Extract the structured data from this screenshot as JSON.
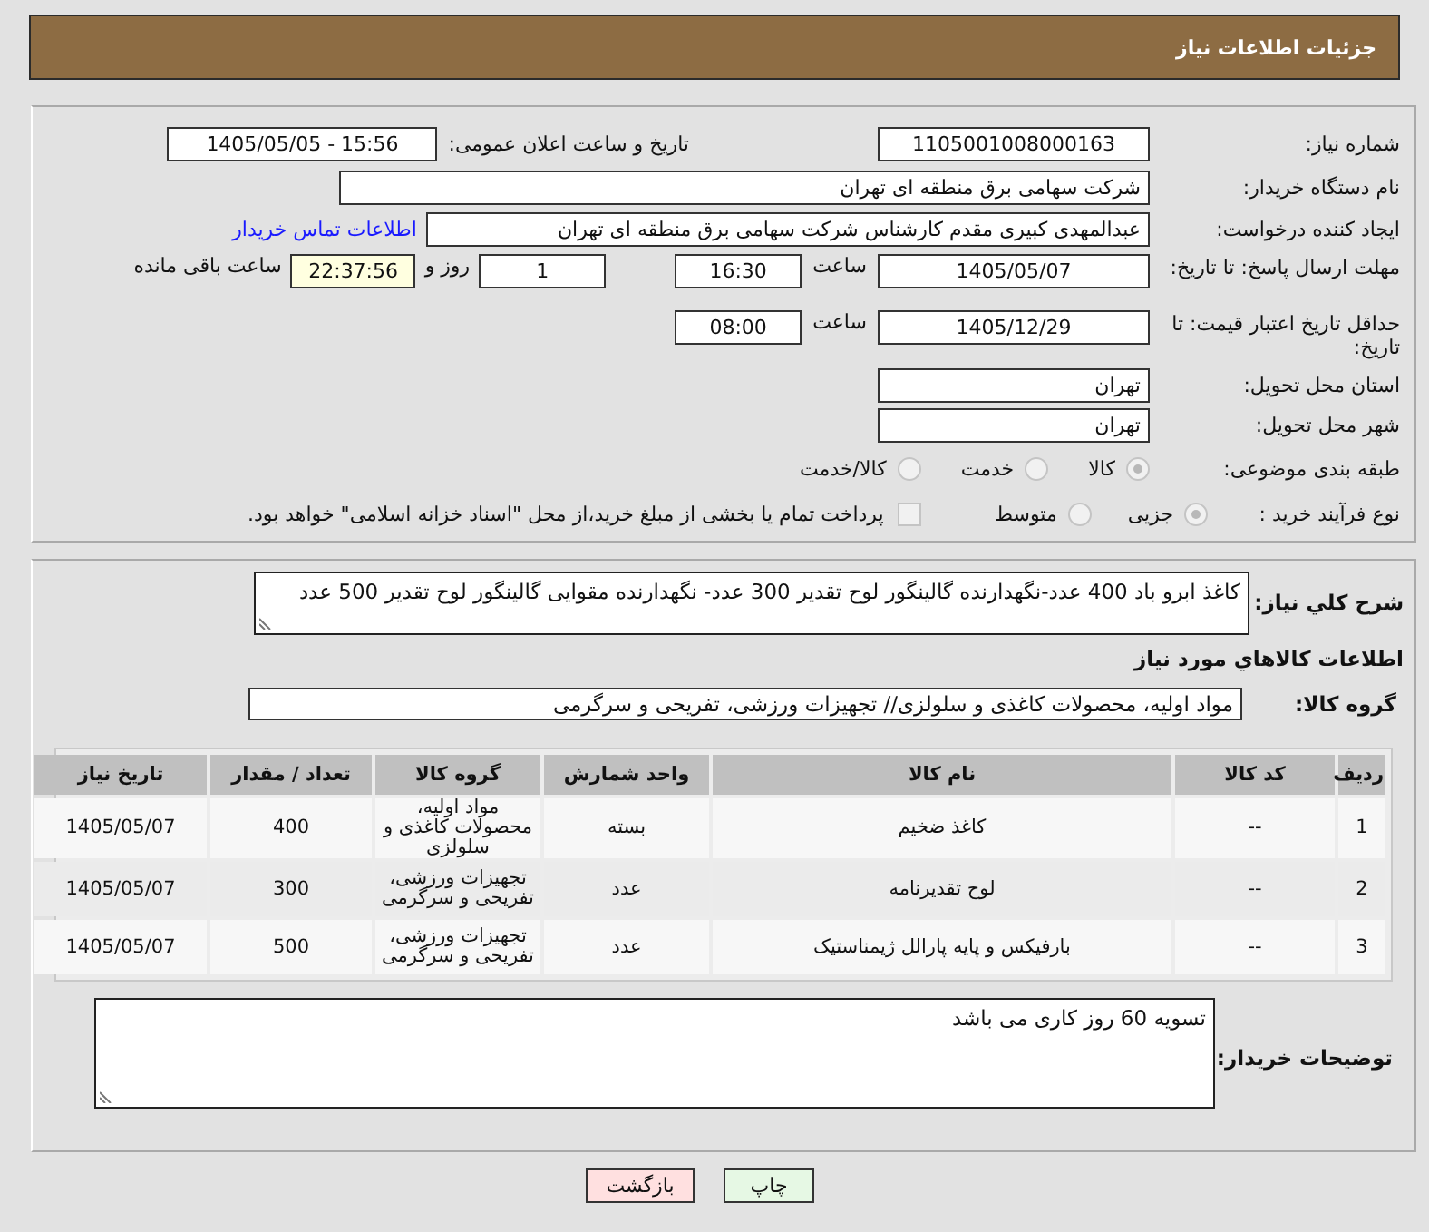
{
  "header": {
    "title": "جزئیات اطلاعات نیاز"
  },
  "info": {
    "need_number": {
      "label": "شماره نیاز:",
      "value": "1105001008000163"
    },
    "announce": {
      "label": "تاریخ و ساعت اعلان عمومی:",
      "value": "1405/05/05 - 15:56"
    },
    "buyer_org": {
      "label": "نام دستگاه خریدار:",
      "value": "شرکت سهامی برق منطقه ای تهران"
    },
    "requester": {
      "label": "ایجاد کننده درخواست:",
      "value": "عبدالمهدی کبیری مقدم کارشناس شرکت سهامی برق منطقه ای تهران",
      "link": "اطلاعات تماس خریدار"
    },
    "reply_deadline": {
      "label": "مهلت ارسال پاسخ: تا تاریخ:",
      "date": "1405/05/07",
      "time_label": "ساعت",
      "time": "16:30",
      "days": "1",
      "days_label": "روز و",
      "remaining": "22:37:56",
      "remaining_label": "ساعت باقی مانده"
    },
    "price_validity": {
      "label": "حداقل تاریخ اعتبار قیمت: تا تاریخ:",
      "date": "1405/12/29",
      "time_label": "ساعت",
      "time": "08:00"
    },
    "province": {
      "label": "استان محل تحویل:",
      "value": "تهران"
    },
    "city": {
      "label": "شهر محل تحویل:",
      "value": "تهران"
    },
    "category": {
      "label": "طبقه بندی موضوعی:",
      "options": [
        {
          "label": "کالا",
          "selected": true
        },
        {
          "label": "خدمت",
          "selected": false
        },
        {
          "label": "کالا/خدمت",
          "selected": false
        }
      ]
    },
    "process": {
      "label": "نوع فرآیند خرید :",
      "options": [
        {
          "label": "جزیی",
          "selected": true
        },
        {
          "label": "متوسط",
          "selected": false
        }
      ],
      "payment": {
        "label": "پرداخت تمام یا بخشی از مبلغ خرید،از محل \"اسناد خزانه اسلامی\" خواهد بود.",
        "checked": false
      }
    }
  },
  "goods": {
    "description": {
      "label": "شرح کلي نياز:",
      "value": "کاغذ ابرو باد 400 عدد-نگهدارنده گالینگور لوح تقدیر 300 عدد- نگهدارنده مقوایی گالینگور لوح تقدیر 500 عدد"
    },
    "section_title": "اطلاعات کالاهاي مورد نياز",
    "group": {
      "label": "گروه کالا:",
      "value": "مواد اولیه، محصولات کاغذی و سلولزی// تجهیزات ورزشی، تفریحی و سرگرمی"
    },
    "table": {
      "columns": [
        "ردیف",
        "کد کالا",
        "نام کالا",
        "واحد شمارش",
        "گروه کالا",
        "تعداد / مقدار",
        "تاریخ نیاز"
      ],
      "rows": [
        [
          "1",
          "--",
          "کاغذ ضخیم",
          "بسته",
          "مواد اولیه، محصولات کاغذی و سلولزی",
          "400",
          "1405/05/07"
        ],
        [
          "2",
          "--",
          "لوح تقدیرنامه",
          "عدد",
          "تجهیزات ورزشی، تفریحی و سرگرمی",
          "300",
          "1405/05/07"
        ],
        [
          "3",
          "--",
          "بارفیکس و پایه پارالل ژیمناستیک",
          "عدد",
          "تجهیزات ورزشی، تفریحی و سرگرمی",
          "500",
          "1405/05/07"
        ]
      ]
    },
    "buyer_notes": {
      "label": "توضیحات خریدار:",
      "value": "تسویه 60 روز کاری می باشد"
    }
  },
  "buttons": [
    {
      "label": "چاپ",
      "kind": "print"
    },
    {
      "label": "بازگشت",
      "kind": "back"
    }
  ]
}
